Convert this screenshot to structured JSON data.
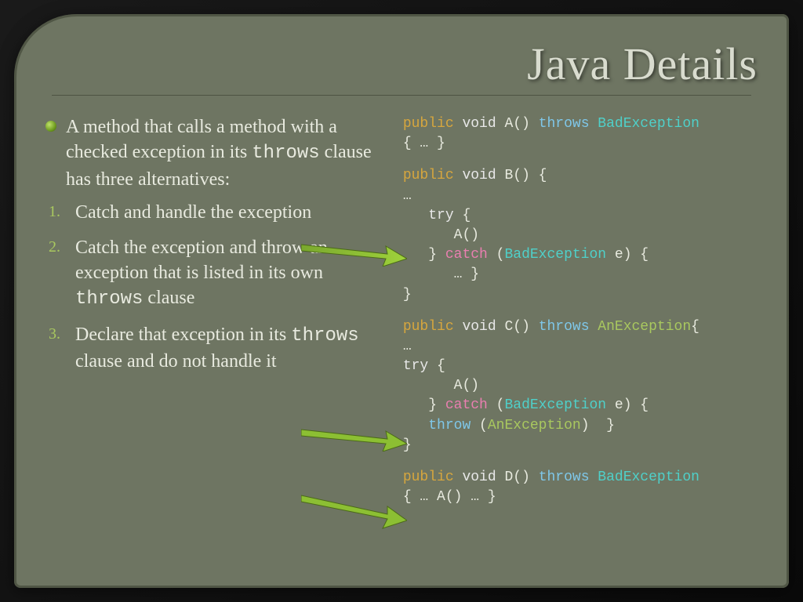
{
  "title": "Java Details",
  "intro": {
    "pre": "A method that calls a method with a checked exception in its ",
    "code": "throws",
    "post": " clause has three alternatives:"
  },
  "alts": [
    {
      "text": "Catch and handle the exception"
    },
    {
      "pre": "Catch the exception and throw an exception that is listed in its own ",
      "code": "throws",
      "post": " clause"
    },
    {
      "pre": "Declare that exception in its ",
      "code": "throws",
      "post": " clause and do not handle it"
    }
  ],
  "code": {
    "A": {
      "l1_public": "public",
      "l1_void": "void",
      "l1_name": " A() ",
      "l1_throws": "throws",
      "l1_ex": " BadException",
      "l2": "{ … }"
    },
    "B": {
      "l1_public": "public",
      "l1_void": "void",
      "l1_name": " B() {",
      "l2": "…",
      "l3_try": "   try",
      "l3_brace": " {",
      "l4": "      A()",
      "l5_close": "   } ",
      "l5_catch": "catch",
      "l5_open": " (",
      "l5_ex": "BadException",
      "l5_rest": " e) {",
      "l6": "      … }",
      "l7": "}"
    },
    "C": {
      "l1_public": "public",
      "l1_void": "void",
      "l1_name": " C() ",
      "l1_throws": "throws",
      "l1_ex": " AnException",
      "l1_end": "{",
      "l2": "…",
      "l3_try": "try",
      "l3_brace": " {",
      "l4": "      A()",
      "l5_close": "   } ",
      "l5_catch": "catch",
      "l5_open": " (",
      "l5_ex": "BadException",
      "l5_rest": " e) {",
      "l6_throw": "   throw",
      "l6_open": " (",
      "l6_ex": "AnException",
      "l6_rest": ")  }",
      "l7": "}"
    },
    "D": {
      "l1_public": "public",
      "l1_void": "void",
      "l1_name": " D() ",
      "l1_throws": "throws",
      "l1_ex": " BadException",
      "l2": "{ … A() … }"
    }
  }
}
